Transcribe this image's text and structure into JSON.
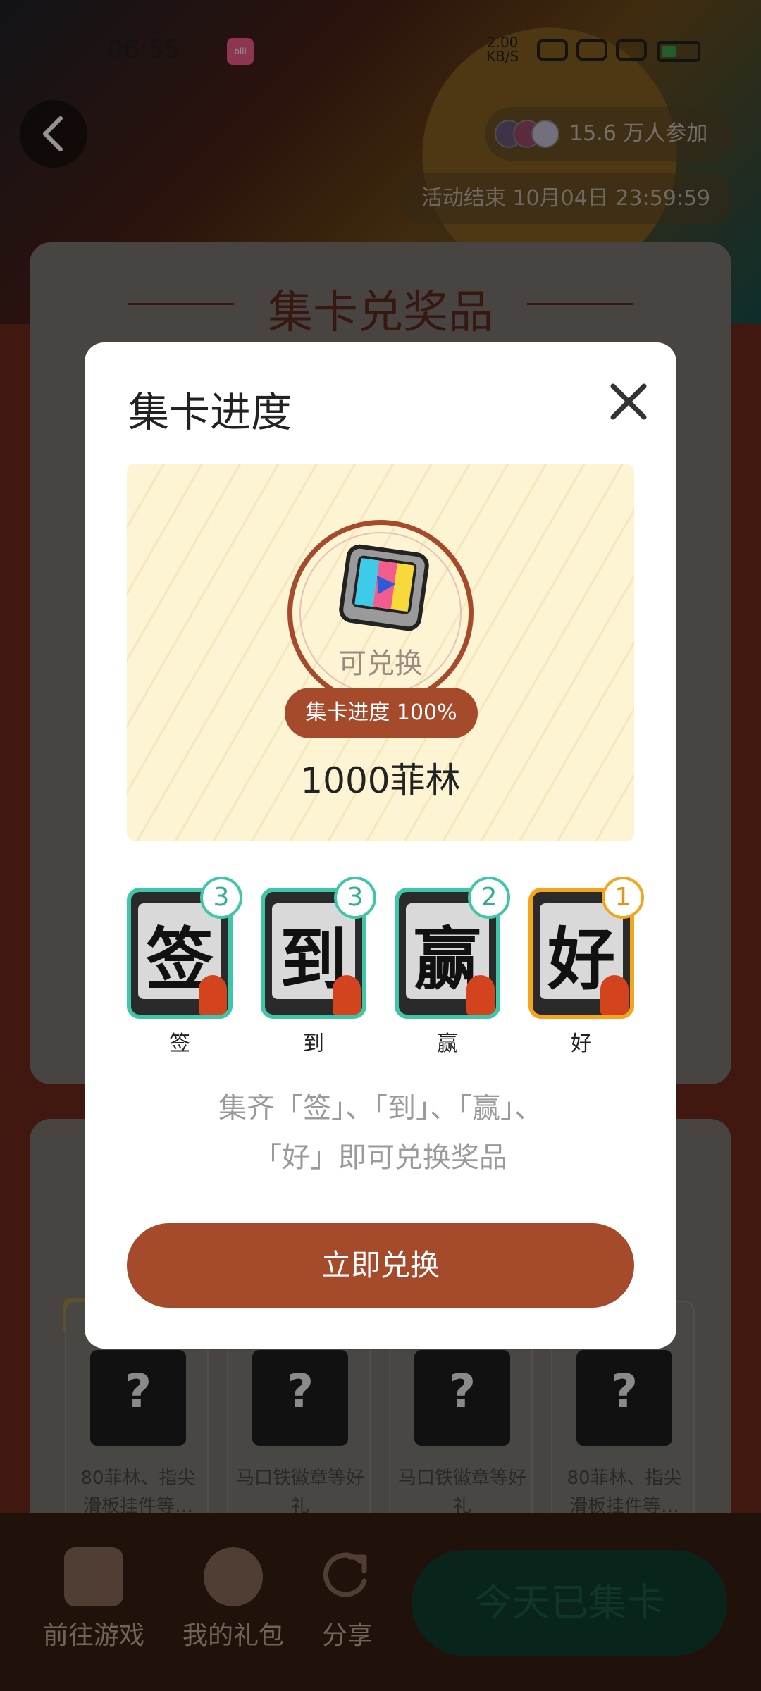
{
  "status_bar": {
    "time": "06:55",
    "app_icon": "bilibili-icon",
    "net_speed_value": "2.00",
    "net_speed_unit": "KB/S",
    "battery_level": "41"
  },
  "header": {
    "participants": "15.6 万人参加",
    "end_time": "活动结束 10月04日 23:59:59"
  },
  "background": {
    "section_title": "集卡兑奖品",
    "prizes": [
      {
        "label": "80菲林、指尖滑板挂件等…"
      },
      {
        "label": "马口铁徽章等好礼"
      },
      {
        "label": "马口铁徽章等好礼"
      },
      {
        "label": "80菲林、指尖滑板挂件等…"
      }
    ]
  },
  "bottom_nav": {
    "items": [
      {
        "label": "前往游戏",
        "icon": "game-icon"
      },
      {
        "label": "我的礼包",
        "icon": "gift-icon"
      },
      {
        "label": "分享",
        "icon": "share-icon"
      }
    ],
    "primary": "今天已集卡"
  },
  "modal": {
    "title": "集卡进度",
    "reward": {
      "status": "可兑换",
      "progress_label": "集卡进度 100%",
      "progress_value": 100,
      "name": "1000菲林",
      "icon": "film-ticket-icon"
    },
    "cards": [
      {
        "glyph": "签",
        "count": "3",
        "label": "签"
      },
      {
        "glyph": "到",
        "count": "3",
        "label": "到"
      },
      {
        "glyph": "赢",
        "count": "2",
        "label": "赢"
      },
      {
        "glyph": "好",
        "count": "1",
        "label": "好"
      }
    ],
    "hint_line1": "集齐「签」、「到」、「赢」、",
    "hint_line2": "「好」即可兑换奖品",
    "redeem_button": "立即兑换"
  },
  "colors": {
    "accent": "#a54b2c",
    "card_border": "#3fc6a9",
    "card_border_highlight": "#f3a51c"
  }
}
